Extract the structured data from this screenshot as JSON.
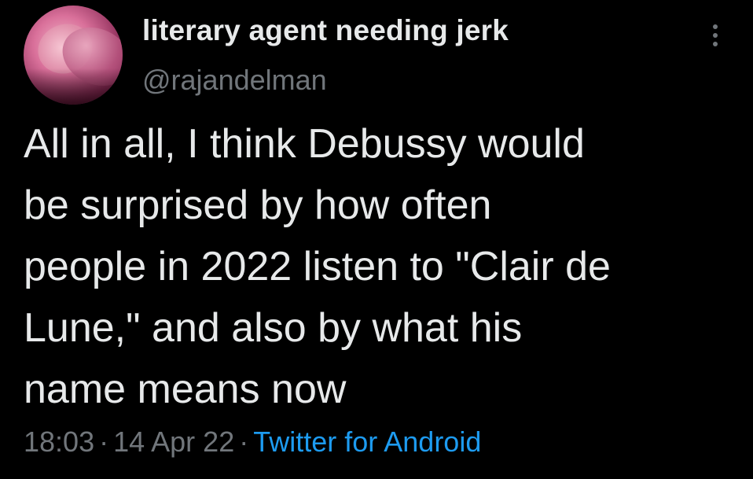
{
  "tweet": {
    "display_name": "literary agent needing jerk",
    "handle": "@rajandelman",
    "lines": [
      "All in all, I think Debussy would",
      "be surprised by how often",
      "people in 2022 listen to \"Clair de",
      "Lune,\" and also by what his",
      "name means now"
    ],
    "time": "18:03",
    "separator": "·",
    "date": "14 Apr 22",
    "source": "Twitter for Android"
  },
  "icons": {
    "more": "more-vertical-icon"
  },
  "colors": {
    "background": "#000000",
    "primary_text": "#e7e9ea",
    "secondary_text": "#71767b",
    "link": "#1d9bf0"
  }
}
